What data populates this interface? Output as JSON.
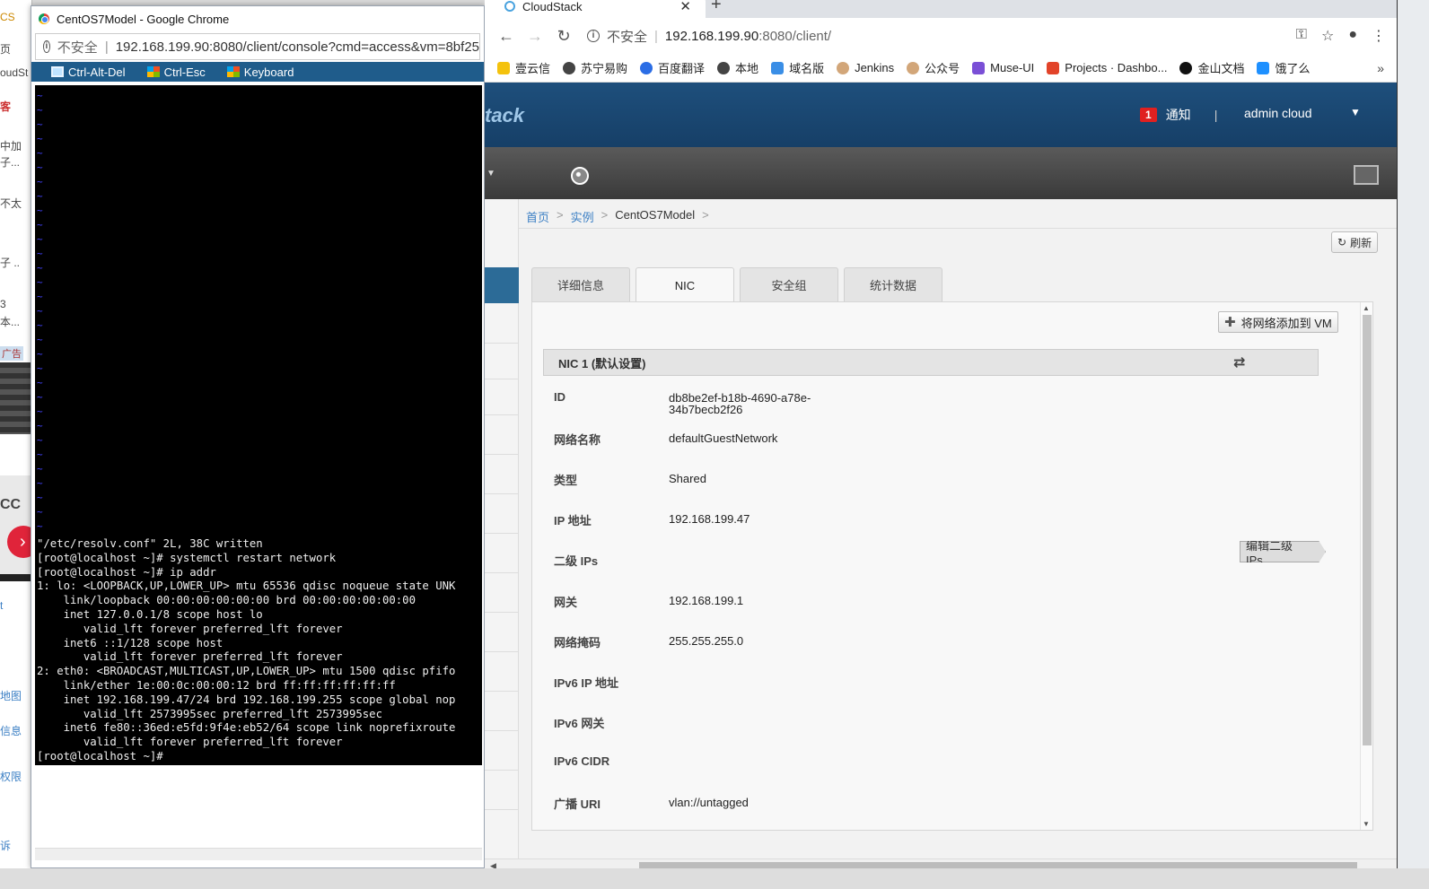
{
  "bg_window": {
    "labels": [
      "CS",
      "页",
      "oudSt",
      "客",
      "中加",
      "子...",
      "不太",
      "子 ..",
      "3",
      "本...",
      "广告",
      "CC",
      "t",
      "地图",
      "信息",
      "权限",
      "诉"
    ]
  },
  "console_window": {
    "title": "CentOS7Model - Google Chrome",
    "security": "不安全",
    "url": "192.168.199.90:8080/client/console?cmd=access&vm=8bf25",
    "buttons": [
      "Ctrl-Alt-Del",
      "Ctrl-Esc",
      "Keyboard"
    ],
    "terminal_lines": [
      "\"/etc/resolv.conf\" 2L, 38C written",
      "[root@localhost ~]# systemctl restart network",
      "[root@localhost ~]# ip addr",
      "1: lo: <LOOPBACK,UP,LOWER_UP> mtu 65536 qdisc noqueue state UNK",
      "    link/loopback 00:00:00:00:00:00 brd 00:00:00:00:00:00",
      "    inet 127.0.0.1/8 scope host lo",
      "       valid_lft forever preferred_lft forever",
      "    inet6 ::1/128 scope host",
      "       valid_lft forever preferred_lft forever",
      "2: eth0: <BROADCAST,MULTICAST,UP,LOWER_UP> mtu 1500 qdisc pfifo",
      "    link/ether 1e:00:0c:00:00:12 brd ff:ff:ff:ff:ff:ff",
      "    inet 192.168.199.47/24 brd 192.168.199.255 scope global nop",
      "       valid_lft 2573995sec preferred_lft 2573995sec",
      "    inet6 fe80::36ed:e5fd:9f4e:eb52/64 scope link noprefixroute",
      "       valid_lft forever preferred_lft forever",
      "[root@localhost ~]#"
    ]
  },
  "browser": {
    "tab_title": "CloudStack",
    "security": "不安全",
    "url_host": "192.168.199.90",
    "url_path": ":8080/client/",
    "bookmarks": [
      "壹云信",
      "苏宁易购",
      "百度翻译",
      "本地",
      "域名版",
      "Jenkins",
      "公众号",
      "Muse-UI",
      "Projects · Dashbo...",
      "金山文档",
      "饿了么"
    ],
    "bookmark_more": "»"
  },
  "cloudstack": {
    "brand": "tack",
    "notify_count": "1",
    "notify_label": "通知",
    "user": "admin cloud",
    "breadcrumb": [
      "首页",
      "实例",
      "CentOS7Model"
    ],
    "refresh": "刷新",
    "tabs": [
      "详细信息",
      "NIC",
      "安全组",
      "统计数据"
    ],
    "add_network_button": "将网络添加到 VM",
    "nic_header": "NIC 1 (默认设置)",
    "edit_secondary_button": "编辑二级 IPs",
    "fields": [
      {
        "key": "ID",
        "value": "db8be2ef-b18b-4690-a78e-\n34b7becb2f26"
      },
      {
        "key": "网络名称",
        "value": "defaultGuestNetwork"
      },
      {
        "key": "类型",
        "value": "Shared"
      },
      {
        "key": "IP 地址",
        "value": "192.168.199.47"
      },
      {
        "key": "二级 IPs",
        "value": ""
      },
      {
        "key": "网关",
        "value": "192.168.199.1"
      },
      {
        "key": "网络掩码",
        "value": "255.255.255.0"
      },
      {
        "key": "IPv6 IP 地址",
        "value": ""
      },
      {
        "key": "IPv6 网关",
        "value": ""
      },
      {
        "key": "IPv6 CIDR",
        "value": ""
      },
      {
        "key": "广播 URI",
        "value": "vlan://untagged"
      }
    ]
  }
}
